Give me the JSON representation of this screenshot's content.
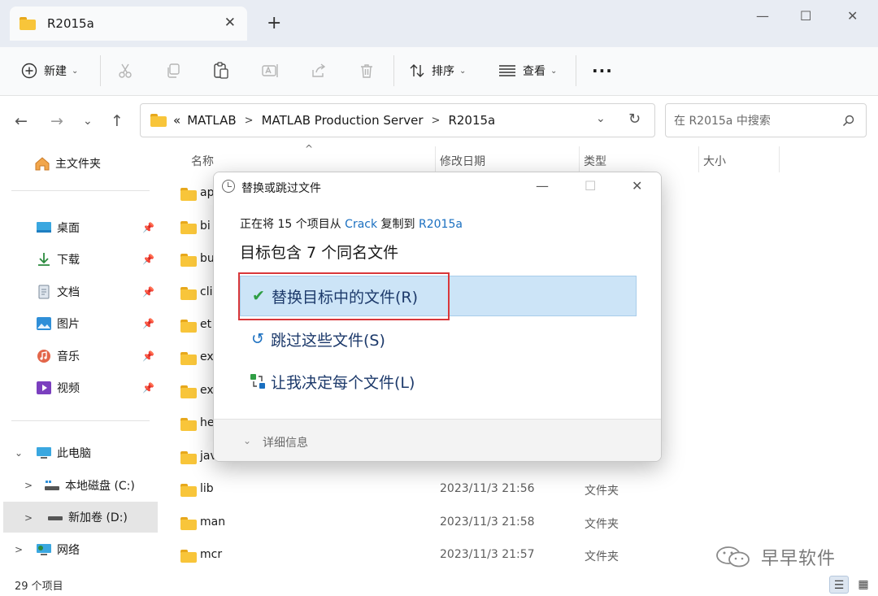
{
  "window": {
    "tab_title": "R2015a",
    "new_tab": "+",
    "minimize": "—",
    "maximize": "☐",
    "close": "✕"
  },
  "toolbar": {
    "new_label": "新建",
    "sort_label": "排序",
    "view_label": "查看",
    "more": "···"
  },
  "address": {
    "overflow": "«",
    "crumbs": [
      "MATLAB",
      "MATLAB Production Server",
      "R2015a"
    ],
    "search_placeholder": "在 R2015a 中搜索"
  },
  "sidebar": {
    "home": "主文件夹",
    "quick": [
      {
        "label": "桌面",
        "icon": "desktop-icon"
      },
      {
        "label": "下载",
        "icon": "download-icon"
      },
      {
        "label": "文档",
        "icon": "document-icon"
      },
      {
        "label": "图片",
        "icon": "pictures-icon"
      },
      {
        "label": "音乐",
        "icon": "music-icon"
      },
      {
        "label": "视频",
        "icon": "video-icon"
      }
    ],
    "this_pc": "此电脑",
    "drive_c": "本地磁盘 (C:)",
    "drive_d": "新加卷 (D:)",
    "network": "网络"
  },
  "columns": {
    "name": "名称",
    "date": "修改日期",
    "type": "类型",
    "size": "大小"
  },
  "files": [
    {
      "name": "ap",
      "date": "",
      "type": ""
    },
    {
      "name": "bi",
      "date": "",
      "type": ""
    },
    {
      "name": "bu",
      "date": "",
      "type": ""
    },
    {
      "name": "cli",
      "date": "",
      "type": ""
    },
    {
      "name": "et",
      "date": "",
      "type": ""
    },
    {
      "name": "ex",
      "date": "",
      "type": ""
    },
    {
      "name": "ex",
      "date": "",
      "type": ""
    },
    {
      "name": "he",
      "date": "",
      "type": ""
    },
    {
      "name": "jav",
      "date": "",
      "type": ""
    },
    {
      "name": "lib",
      "date": "2023/11/3 21:56",
      "type": "文件夹"
    },
    {
      "name": "man",
      "date": "2023/11/3 21:58",
      "type": "文件夹"
    },
    {
      "name": "mcr",
      "date": "2023/11/3 21:57",
      "type": "文件夹"
    }
  ],
  "status": {
    "count": "29 个项目"
  },
  "dialog": {
    "title": "替换或跳过文件",
    "line1_prefix": "正在将 15 个项目从 ",
    "line1_src": "Crack",
    "line1_mid": " 复制到 ",
    "line1_dst": "R2015a",
    "line2": "目标包含 7 个同名文件",
    "opt_replace": "替换目标中的文件(R)",
    "opt_skip": "跳过这些文件(S)",
    "opt_decide": "让我决定每个文件(L)",
    "details": "详细信息"
  },
  "watermark": {
    "text": "早早软件"
  },
  "colors": {
    "accent": "#1a6fc0",
    "highlight": "#cce4f7",
    "annotation": "#d9373a",
    "folder": "#f8c53a"
  }
}
